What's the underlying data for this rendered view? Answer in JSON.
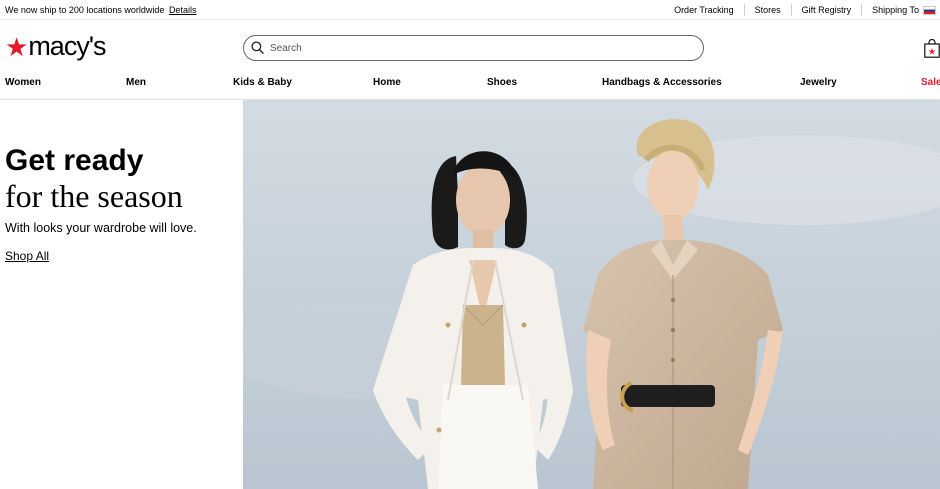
{
  "topbar": {
    "ship_text": "We now ship to 200 locations worldwide",
    "details_link": "Details",
    "links": [
      "Order Tracking",
      "Stores",
      "Gift Registry",
      "Shipping To"
    ]
  },
  "header": {
    "logo_text": "macy's",
    "search_placeholder": "Search"
  },
  "nav": {
    "items": [
      "Women",
      "Men",
      "Kids & Baby",
      "Home",
      "Shoes",
      "Handbags & Accessories",
      "Jewelry",
      "Sale"
    ]
  },
  "promo": {
    "headline": "Get ready",
    "headline2": "for the season",
    "subtitle": "With looks your wardrobe will love.",
    "cta": "Shop All"
  },
  "colors": {
    "brand_red": "#e21a2c",
    "sky": "#c9d3db"
  },
  "icons": [
    "star-logo-icon",
    "search-icon",
    "shopping-bag-icon",
    "flag-icon"
  ]
}
